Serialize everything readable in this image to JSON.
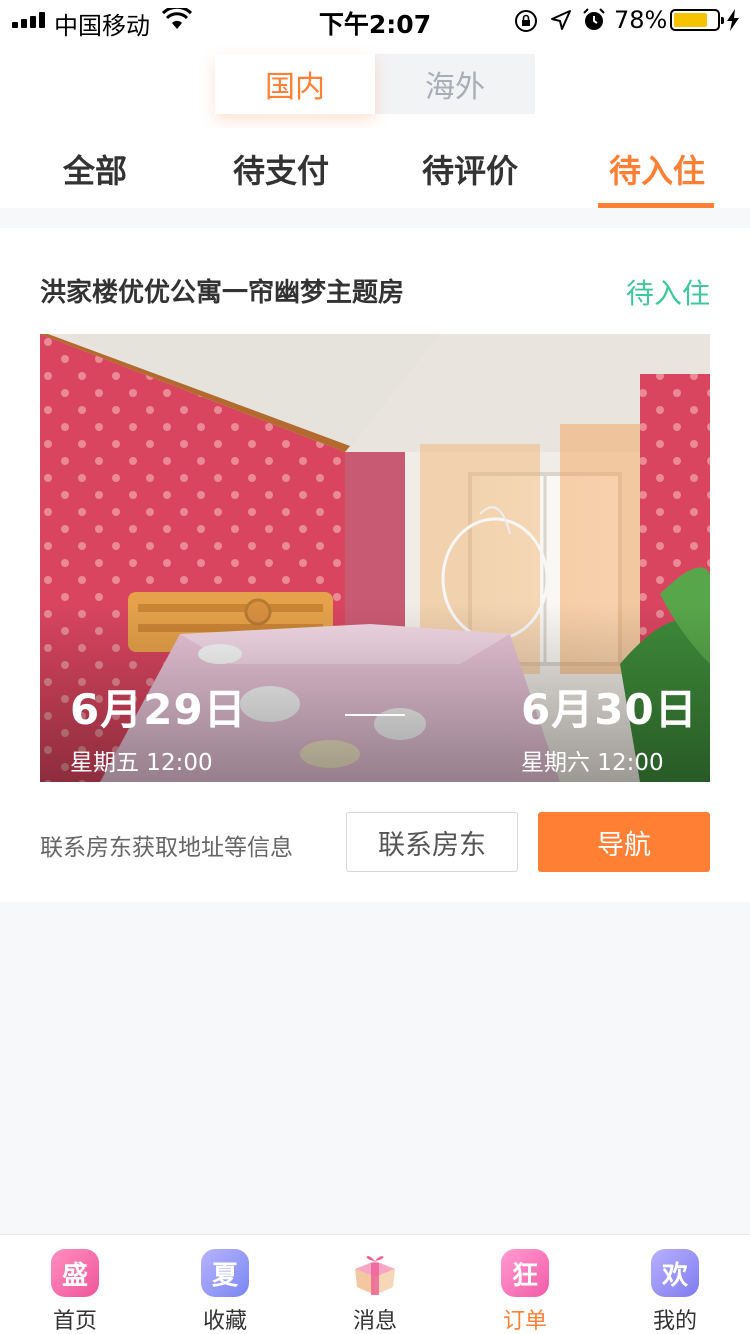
{
  "status_bar": {
    "carrier": "中国移动",
    "time": "下午2:07",
    "battery_percent": "78%",
    "battery_level": 0.78,
    "icons": [
      "signal-icon",
      "wifi-icon",
      "rotation-lock-icon",
      "location-icon",
      "alarm-icon",
      "battery-icon",
      "charging-icon"
    ]
  },
  "region": {
    "options": [
      {
        "label": "国内",
        "active": true
      },
      {
        "label": "海外",
        "active": false
      }
    ]
  },
  "tabs": [
    {
      "label": "全部",
      "active": false
    },
    {
      "label": "待支付",
      "active": false
    },
    {
      "label": "待评价",
      "active": false
    },
    {
      "label": "待入住",
      "active": true
    }
  ],
  "order": {
    "title": "洪家楼优优公寓一帘幽梦主题房",
    "status": "待入住",
    "checkin": {
      "date": "6月29日",
      "detail": "星期五 12:00"
    },
    "checkout": {
      "date": "6月30日",
      "detail": "星期六 12:00"
    },
    "contact_hint": "联系房东获取地址等信息",
    "contact_button": "联系房东",
    "nav_button": "导航"
  },
  "bottom_nav": [
    {
      "label": "首页",
      "icon_char": "盛",
      "icon": "home-icon",
      "active": false
    },
    {
      "label": "收藏",
      "icon_char": "夏",
      "icon": "favorites-icon",
      "active": false
    },
    {
      "label": "消息",
      "icon_char": "",
      "icon": "gift-box-icon",
      "active": false
    },
    {
      "label": "订单",
      "icon_char": "狂",
      "icon": "orders-icon",
      "active": true
    },
    {
      "label": "我的",
      "icon_char": "欢",
      "icon": "profile-icon",
      "active": false
    }
  ],
  "colors": {
    "accent": "#ff7f34",
    "status_green": "#3fc99a",
    "background": "#f7f8fa"
  }
}
